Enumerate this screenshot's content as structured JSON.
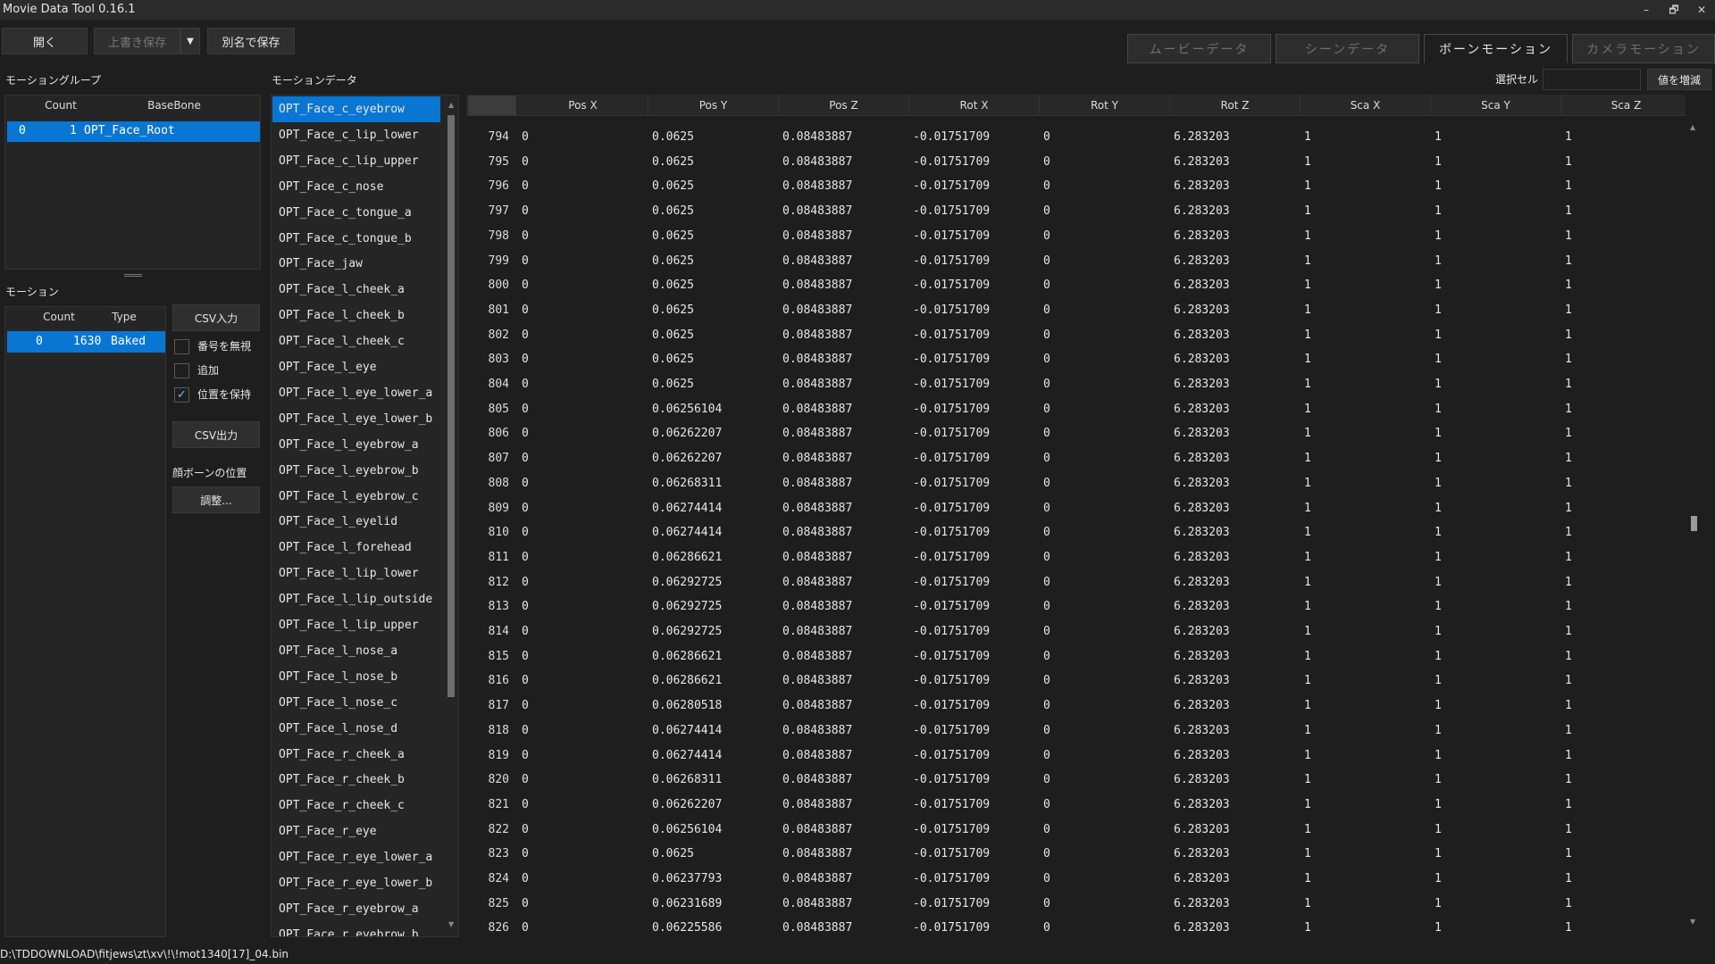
{
  "app": {
    "title": "Movie Data Tool 0.16.1"
  },
  "window_controls": [
    "–",
    "🗗",
    "✕"
  ],
  "toolbar": {
    "open": "開く",
    "overwrite": "上書き保存",
    "dropdown": "▼",
    "save_as": "別名で保存"
  },
  "tabs": [
    {
      "label": "ムービーデータ",
      "active": false
    },
    {
      "label": "シーンデータ",
      "active": false
    },
    {
      "label": "ボーンモーション",
      "active": true
    },
    {
      "label": "カメラモーション",
      "active": false
    }
  ],
  "motion_group": {
    "label": "モーショングループ",
    "columns": [
      "Count",
      "BaseBone"
    ],
    "rows": [
      {
        "index": "0",
        "count": "1",
        "base_bone": "OPT_Face_Root"
      }
    ]
  },
  "motion": {
    "label": "モーション",
    "columns": [
      "Count",
      "Type"
    ],
    "rows": [
      {
        "index": "0",
        "count": "1630",
        "type": "Baked"
      }
    ],
    "csv_in": "CSV入力",
    "ignore_number": "番号を無視",
    "append": "追加",
    "keep_position": "位置を保持",
    "csv_out": "CSV出力",
    "face_bone_label": "顔ボーンの位置",
    "adjust": "調整..."
  },
  "motion_data": {
    "label": "モーションデータ",
    "selected_index": 0,
    "bones": [
      "OPT_Face_c_eyebrow",
      "OPT_Face_c_lip_lower",
      "OPT_Face_c_lip_upper",
      "OPT_Face_c_nose",
      "OPT_Face_c_tongue_a",
      "OPT_Face_c_tongue_b",
      "OPT_Face_jaw",
      "OPT_Face_l_cheek_a",
      "OPT_Face_l_cheek_b",
      "OPT_Face_l_cheek_c",
      "OPT_Face_l_eye",
      "OPT_Face_l_eye_lower_a",
      "OPT_Face_l_eye_lower_b",
      "OPT_Face_l_eyebrow_a",
      "OPT_Face_l_eyebrow_b",
      "OPT_Face_l_eyebrow_c",
      "OPT_Face_l_eyelid",
      "OPT_Face_l_forehead",
      "OPT_Face_l_lip_lower",
      "OPT_Face_l_lip_outside",
      "OPT_Face_l_lip_upper",
      "OPT_Face_l_nose_a",
      "OPT_Face_l_nose_b",
      "OPT_Face_l_nose_c",
      "OPT_Face_l_nose_d",
      "OPT_Face_r_cheek_a",
      "OPT_Face_r_cheek_b",
      "OPT_Face_r_cheek_c",
      "OPT_Face_r_eye",
      "OPT_Face_r_eye_lower_a",
      "OPT_Face_r_eye_lower_b",
      "OPT_Face_r_eyebrow_a",
      "OPT_Face_r_eyebrow_b"
    ]
  },
  "grid": {
    "selected_cell_label": "選択セル",
    "selected_cell_value": "",
    "increase_button": "値を増減",
    "columns": [
      "Pos X",
      "Pos Y",
      "Pos Z",
      "Rot X",
      "Rot Y",
      "Rot Z",
      "Sca X",
      "Sca Y",
      "Sca Z"
    ],
    "rows": [
      [
        "794",
        "0",
        "0.0625",
        "0.08483887",
        "-0.01751709",
        "0",
        "6.283203",
        "1",
        "1",
        "1"
      ],
      [
        "795",
        "0",
        "0.0625",
        "0.08483887",
        "-0.01751709",
        "0",
        "6.283203",
        "1",
        "1",
        "1"
      ],
      [
        "796",
        "0",
        "0.0625",
        "0.08483887",
        "-0.01751709",
        "0",
        "6.283203",
        "1",
        "1",
        "1"
      ],
      [
        "797",
        "0",
        "0.0625",
        "0.08483887",
        "-0.01751709",
        "0",
        "6.283203",
        "1",
        "1",
        "1"
      ],
      [
        "798",
        "0",
        "0.0625",
        "0.08483887",
        "-0.01751709",
        "0",
        "6.283203",
        "1",
        "1",
        "1"
      ],
      [
        "799",
        "0",
        "0.0625",
        "0.08483887",
        "-0.01751709",
        "0",
        "6.283203",
        "1",
        "1",
        "1"
      ],
      [
        "800",
        "0",
        "0.0625",
        "0.08483887",
        "-0.01751709",
        "0",
        "6.283203",
        "1",
        "1",
        "1"
      ],
      [
        "801",
        "0",
        "0.0625",
        "0.08483887",
        "-0.01751709",
        "0",
        "6.283203",
        "1",
        "1",
        "1"
      ],
      [
        "802",
        "0",
        "0.0625",
        "0.08483887",
        "-0.01751709",
        "0",
        "6.283203",
        "1",
        "1",
        "1"
      ],
      [
        "803",
        "0",
        "0.0625",
        "0.08483887",
        "-0.01751709",
        "0",
        "6.283203",
        "1",
        "1",
        "1"
      ],
      [
        "804",
        "0",
        "0.0625",
        "0.08483887",
        "-0.01751709",
        "0",
        "6.283203",
        "1",
        "1",
        "1"
      ],
      [
        "805",
        "0",
        "0.06256104",
        "0.08483887",
        "-0.01751709",
        "0",
        "6.283203",
        "1",
        "1",
        "1"
      ],
      [
        "806",
        "0",
        "0.06262207",
        "0.08483887",
        "-0.01751709",
        "0",
        "6.283203",
        "1",
        "1",
        "1"
      ],
      [
        "807",
        "0",
        "0.06262207",
        "0.08483887",
        "-0.01751709",
        "0",
        "6.283203",
        "1",
        "1",
        "1"
      ],
      [
        "808",
        "0",
        "0.06268311",
        "0.08483887",
        "-0.01751709",
        "0",
        "6.283203",
        "1",
        "1",
        "1"
      ],
      [
        "809",
        "0",
        "0.06274414",
        "0.08483887",
        "-0.01751709",
        "0",
        "6.283203",
        "1",
        "1",
        "1"
      ],
      [
        "810",
        "0",
        "0.06274414",
        "0.08483887",
        "-0.01751709",
        "0",
        "6.283203",
        "1",
        "1",
        "1"
      ],
      [
        "811",
        "0",
        "0.06286621",
        "0.08483887",
        "-0.01751709",
        "0",
        "6.283203",
        "1",
        "1",
        "1"
      ],
      [
        "812",
        "0",
        "0.06292725",
        "0.08483887",
        "-0.01751709",
        "0",
        "6.283203",
        "1",
        "1",
        "1"
      ],
      [
        "813",
        "0",
        "0.06292725",
        "0.08483887",
        "-0.01751709",
        "0",
        "6.283203",
        "1",
        "1",
        "1"
      ],
      [
        "814",
        "0",
        "0.06292725",
        "0.08483887",
        "-0.01751709",
        "0",
        "6.283203",
        "1",
        "1",
        "1"
      ],
      [
        "815",
        "0",
        "0.06286621",
        "0.08483887",
        "-0.01751709",
        "0",
        "6.283203",
        "1",
        "1",
        "1"
      ],
      [
        "816",
        "0",
        "0.06286621",
        "0.08483887",
        "-0.01751709",
        "0",
        "6.283203",
        "1",
        "1",
        "1"
      ],
      [
        "817",
        "0",
        "0.06280518",
        "0.08483887",
        "-0.01751709",
        "0",
        "6.283203",
        "1",
        "1",
        "1"
      ],
      [
        "818",
        "0",
        "0.06274414",
        "0.08483887",
        "-0.01751709",
        "0",
        "6.283203",
        "1",
        "1",
        "1"
      ],
      [
        "819",
        "0",
        "0.06274414",
        "0.08483887",
        "-0.01751709",
        "0",
        "6.283203",
        "1",
        "1",
        "1"
      ],
      [
        "820",
        "0",
        "0.06268311",
        "0.08483887",
        "-0.01751709",
        "0",
        "6.283203",
        "1",
        "1",
        "1"
      ],
      [
        "821",
        "0",
        "0.06262207",
        "0.08483887",
        "-0.01751709",
        "0",
        "6.283203",
        "1",
        "1",
        "1"
      ],
      [
        "822",
        "0",
        "0.06256104",
        "0.08483887",
        "-0.01751709",
        "0",
        "6.283203",
        "1",
        "1",
        "1"
      ],
      [
        "823",
        "0",
        "0.0625",
        "0.08483887",
        "-0.01751709",
        "0",
        "6.283203",
        "1",
        "1",
        "1"
      ],
      [
        "824",
        "0",
        "0.06237793",
        "0.08483887",
        "-0.01751709",
        "0",
        "6.283203",
        "1",
        "1",
        "1"
      ],
      [
        "825",
        "0",
        "0.06231689",
        "0.08483887",
        "-0.01751709",
        "0",
        "6.283203",
        "1",
        "1",
        "1"
      ],
      [
        "826",
        "0",
        "0.06225586",
        "0.08483887",
        "-0.01751709",
        "0",
        "6.283203",
        "1",
        "1",
        "1"
      ]
    ]
  },
  "status_bar": {
    "path": "D:\\TDDOWNLOAD\\fitjews\\zt\\xv\\!\\!mot1340[17]_04.bin"
  },
  "colors": {
    "accent": "#0a76d4",
    "bg": "#1e1e1e",
    "panel": "#252526"
  }
}
